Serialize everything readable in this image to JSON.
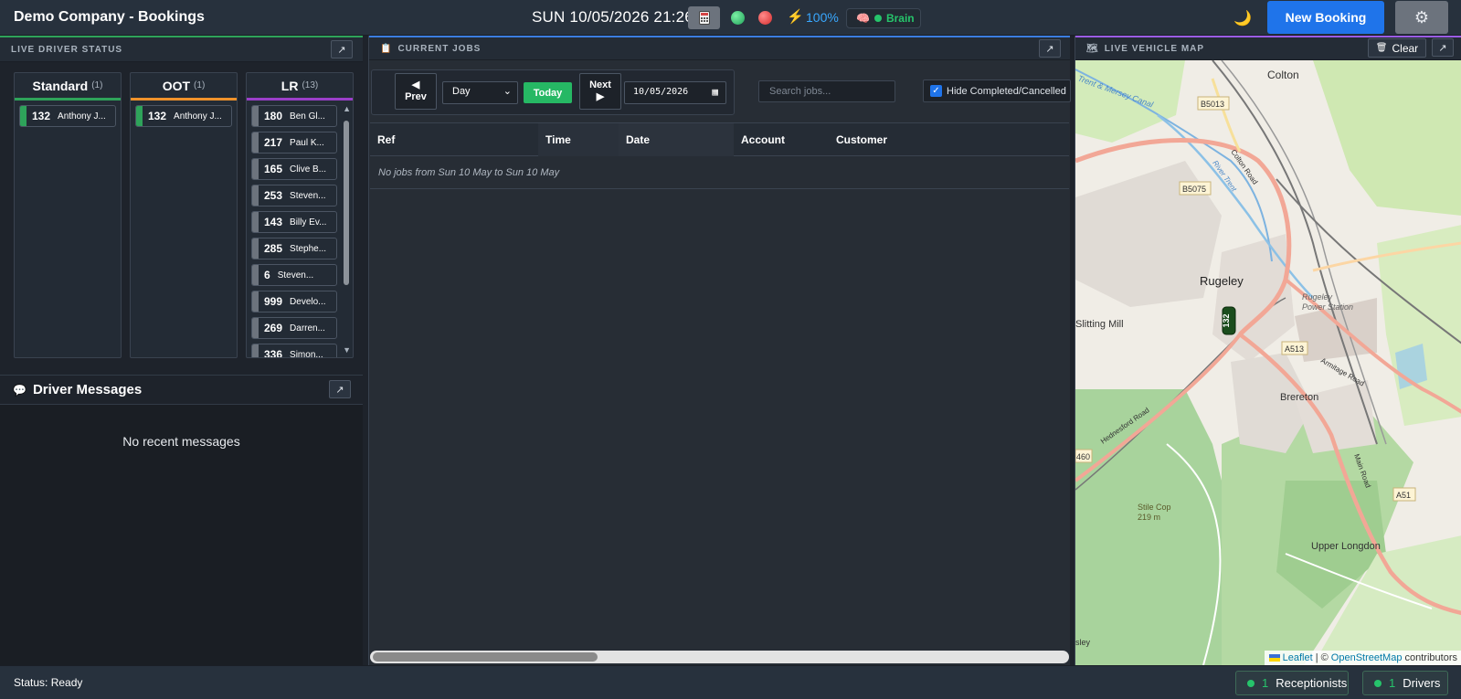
{
  "header": {
    "title": "Demo Company - Bookings",
    "clock": "SUN 10/05/2026 21:26",
    "battery": "100%",
    "brain_label": "Brain",
    "new_booking": "New Booking"
  },
  "driver_status": {
    "title": "LIVE DRIVER STATUS",
    "columns": [
      {
        "label": "Standard",
        "count": "(1)",
        "color": "#2ea35a",
        "drivers": [
          {
            "num": "132",
            "name": "Anthony J...",
            "status_color": "#2ea35a"
          }
        ]
      },
      {
        "label": "OOT",
        "count": "(1)",
        "color": "#f0922b",
        "drivers": [
          {
            "num": "132",
            "name": "Anthony J...",
            "status_color": "#2ea35a"
          }
        ]
      },
      {
        "label": "LR",
        "count": "(13)",
        "color": "#9b3fc9",
        "drivers": [
          {
            "num": "180",
            "name": "Ben Gl...",
            "status_color": "#6c737d"
          },
          {
            "num": "217",
            "name": "Paul K...",
            "status_color": "#6c737d"
          },
          {
            "num": "165",
            "name": "Clive B...",
            "status_color": "#6c737d"
          },
          {
            "num": "253",
            "name": "Steven...",
            "status_color": "#6c737d"
          },
          {
            "num": "143",
            "name": "Billy Ev...",
            "status_color": "#6c737d"
          },
          {
            "num": "285",
            "name": "Stephe...",
            "status_color": "#6c737d"
          },
          {
            "num": "6",
            "name": "Steven...",
            "status_color": "#6c737d"
          },
          {
            "num": "999",
            "name": "Develo...",
            "status_color": "#6c737d"
          },
          {
            "num": "269",
            "name": "Darren...",
            "status_color": "#6c737d"
          },
          {
            "num": "336",
            "name": "Simon...",
            "status_color": "#6c737d"
          }
        ]
      }
    ]
  },
  "messages": {
    "title": "Driver Messages",
    "empty": "No recent messages"
  },
  "jobs": {
    "title": "CURRENT JOBS",
    "prev_label": "Prev",
    "next_label": "Next",
    "view_mode": "Day",
    "today_label": "Today",
    "date_value": "10/05/2026",
    "search_placeholder": "Search jobs...",
    "hide_label": "Hide Completed/Cancelled",
    "hide_checked": true,
    "columns": [
      "Ref",
      "Time",
      "Date",
      "Account",
      "Customer"
    ],
    "empty": "No jobs from Sun 10 May to Sun 10 May"
  },
  "map": {
    "title": "LIVE VEHICLE MAP",
    "clear_label": "Clear",
    "labels": {
      "colton": "Colton",
      "rugeley": "Rugeley",
      "slitting_mill": "Slitting Mill",
      "brereton": "Brereton",
      "power_station": "Rugeley\nPower Station",
      "stile_cop": "Stile Cop\n219 m",
      "upper_longdon": "Upper Longdon",
      "canal": "Trent & Mersey Canal",
      "river": "River Trent",
      "colton_road": "Colton Road",
      "armitage_road": "Armitage Road",
      "hednesford_road": "Hednesford Road",
      "main_road": "Main Road",
      "b5013": "B5013",
      "b5075": "B5075",
      "a513": "A513",
      "a51": "A51",
      "a460": "460",
      "vehicle": "132",
      "edge_label": "sley"
    },
    "attribution_leaflet": "Leaflet",
    "attribution_sep": "| ©",
    "attribution_osm": "OpenStreetMap",
    "attribution_tail": "contributors"
  },
  "status": {
    "text": "Status: Ready",
    "receptionists_count": "1",
    "receptionists_label": "Receptionists",
    "drivers_count": "1",
    "drivers_label": "Drivers"
  }
}
